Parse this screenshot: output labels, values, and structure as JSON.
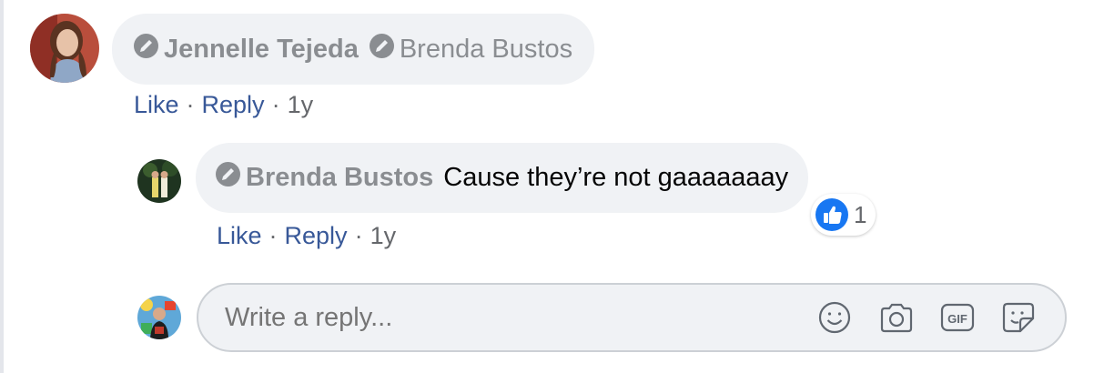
{
  "comment": {
    "author": "Jennelle Tejeda",
    "mention": "Brenda Bustos",
    "like_label": "Like",
    "reply_label": "Reply",
    "separator": "·",
    "time": "1y"
  },
  "reply": {
    "author": "Brenda Bustos",
    "text": "Cause they’re not gaaaaaaay",
    "like_label": "Like",
    "reply_label": "Reply",
    "separator": "·",
    "time": "1y",
    "reaction_count": "1",
    "reaction_icon": "thumbs-up-icon"
  },
  "composer": {
    "placeholder": "Write a reply...",
    "icons": [
      "emoji-icon",
      "camera-icon",
      "gif-icon",
      "sticker-icon"
    ]
  },
  "colors": {
    "bubble_bg": "#f0f2f5",
    "link": "#385898",
    "name": "#8a8d91",
    "like_blue": "#1877f2"
  }
}
